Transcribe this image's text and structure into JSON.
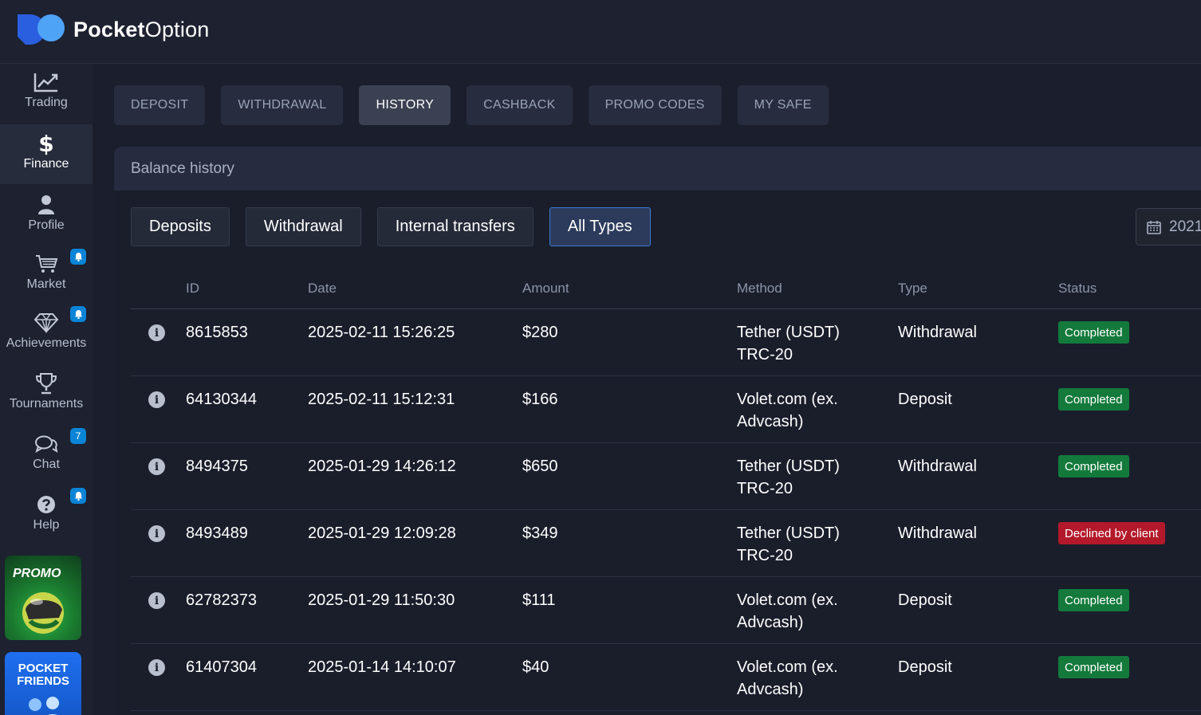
{
  "brand": {
    "name_bold": "Pocket",
    "name_thin": "Option"
  },
  "sidebar": {
    "items": [
      {
        "label": "Trading",
        "icon": "chart-line-icon"
      },
      {
        "label": "Finance",
        "icon": "dollar-icon"
      },
      {
        "label": "Profile",
        "icon": "user-icon"
      },
      {
        "label": "Market",
        "icon": "cart-icon",
        "badge": "bell"
      },
      {
        "label": "Achievements",
        "icon": "diamond-icon",
        "badge": "bell"
      },
      {
        "label": "Tournaments",
        "icon": "trophy-icon"
      },
      {
        "label": "Chat",
        "icon": "chat-icon",
        "badge": "7"
      },
      {
        "label": "Help",
        "icon": "help-icon",
        "badge": "bell"
      }
    ],
    "promo_label": "PROMO",
    "friends_line1": "POCKET",
    "friends_line2": "FRIENDS"
  },
  "tabs": [
    "DEPOSIT",
    "WITHDRAWAL",
    "HISTORY",
    "CASHBACK",
    "PROMO CODES",
    "MY SAFE"
  ],
  "active_tab": "HISTORY",
  "panel": {
    "title": "Balance history"
  },
  "filters": [
    "Deposits",
    "Withdrawal",
    "Internal transfers",
    "All Types"
  ],
  "active_filter": "All Types",
  "date_range": "2021",
  "table": {
    "headers": {
      "id": "ID",
      "date": "Date",
      "amount": "Amount",
      "method": "Method",
      "type": "Type",
      "status": "Status"
    },
    "rows": [
      {
        "id": "8615853",
        "date": "2025-02-11 15:26:25",
        "amount": "$280",
        "method1": "Tether (USDT)",
        "method2": "TRC-20",
        "type": "Withdrawal",
        "status": "Completed",
        "status_kind": "ok"
      },
      {
        "id": "64130344",
        "date": "2025-02-11 15:12:31",
        "amount": "$166",
        "method1": "Volet.com (ex.",
        "method2": "Advcash)",
        "type": "Deposit",
        "status": "Completed",
        "status_kind": "ok"
      },
      {
        "id": "8494375",
        "date": "2025-01-29 14:26:12",
        "amount": "$650",
        "method1": "Tether (USDT)",
        "method2": "TRC-20",
        "type": "Withdrawal",
        "status": "Completed",
        "status_kind": "ok"
      },
      {
        "id": "8493489",
        "date": "2025-01-29 12:09:28",
        "amount": "$349",
        "method1": "Tether (USDT)",
        "method2": "TRC-20",
        "type": "Withdrawal",
        "status": "Declined by client",
        "status_kind": "bad"
      },
      {
        "id": "62782373",
        "date": "2025-01-29 11:50:30",
        "amount": "$111",
        "method1": "Volet.com (ex.",
        "method2": "Advcash)",
        "type": "Deposit",
        "status": "Completed",
        "status_kind": "ok"
      },
      {
        "id": "61407304",
        "date": "2025-01-14 14:10:07",
        "amount": "$40",
        "method1": "Volet.com (ex.",
        "method2": "Advcash)",
        "type": "Deposit",
        "status": "Completed",
        "status_kind": "ok"
      }
    ]
  },
  "colors": {
    "accent": "#0a84d6",
    "completed": "#137a3c",
    "declined": "#b3192a"
  }
}
